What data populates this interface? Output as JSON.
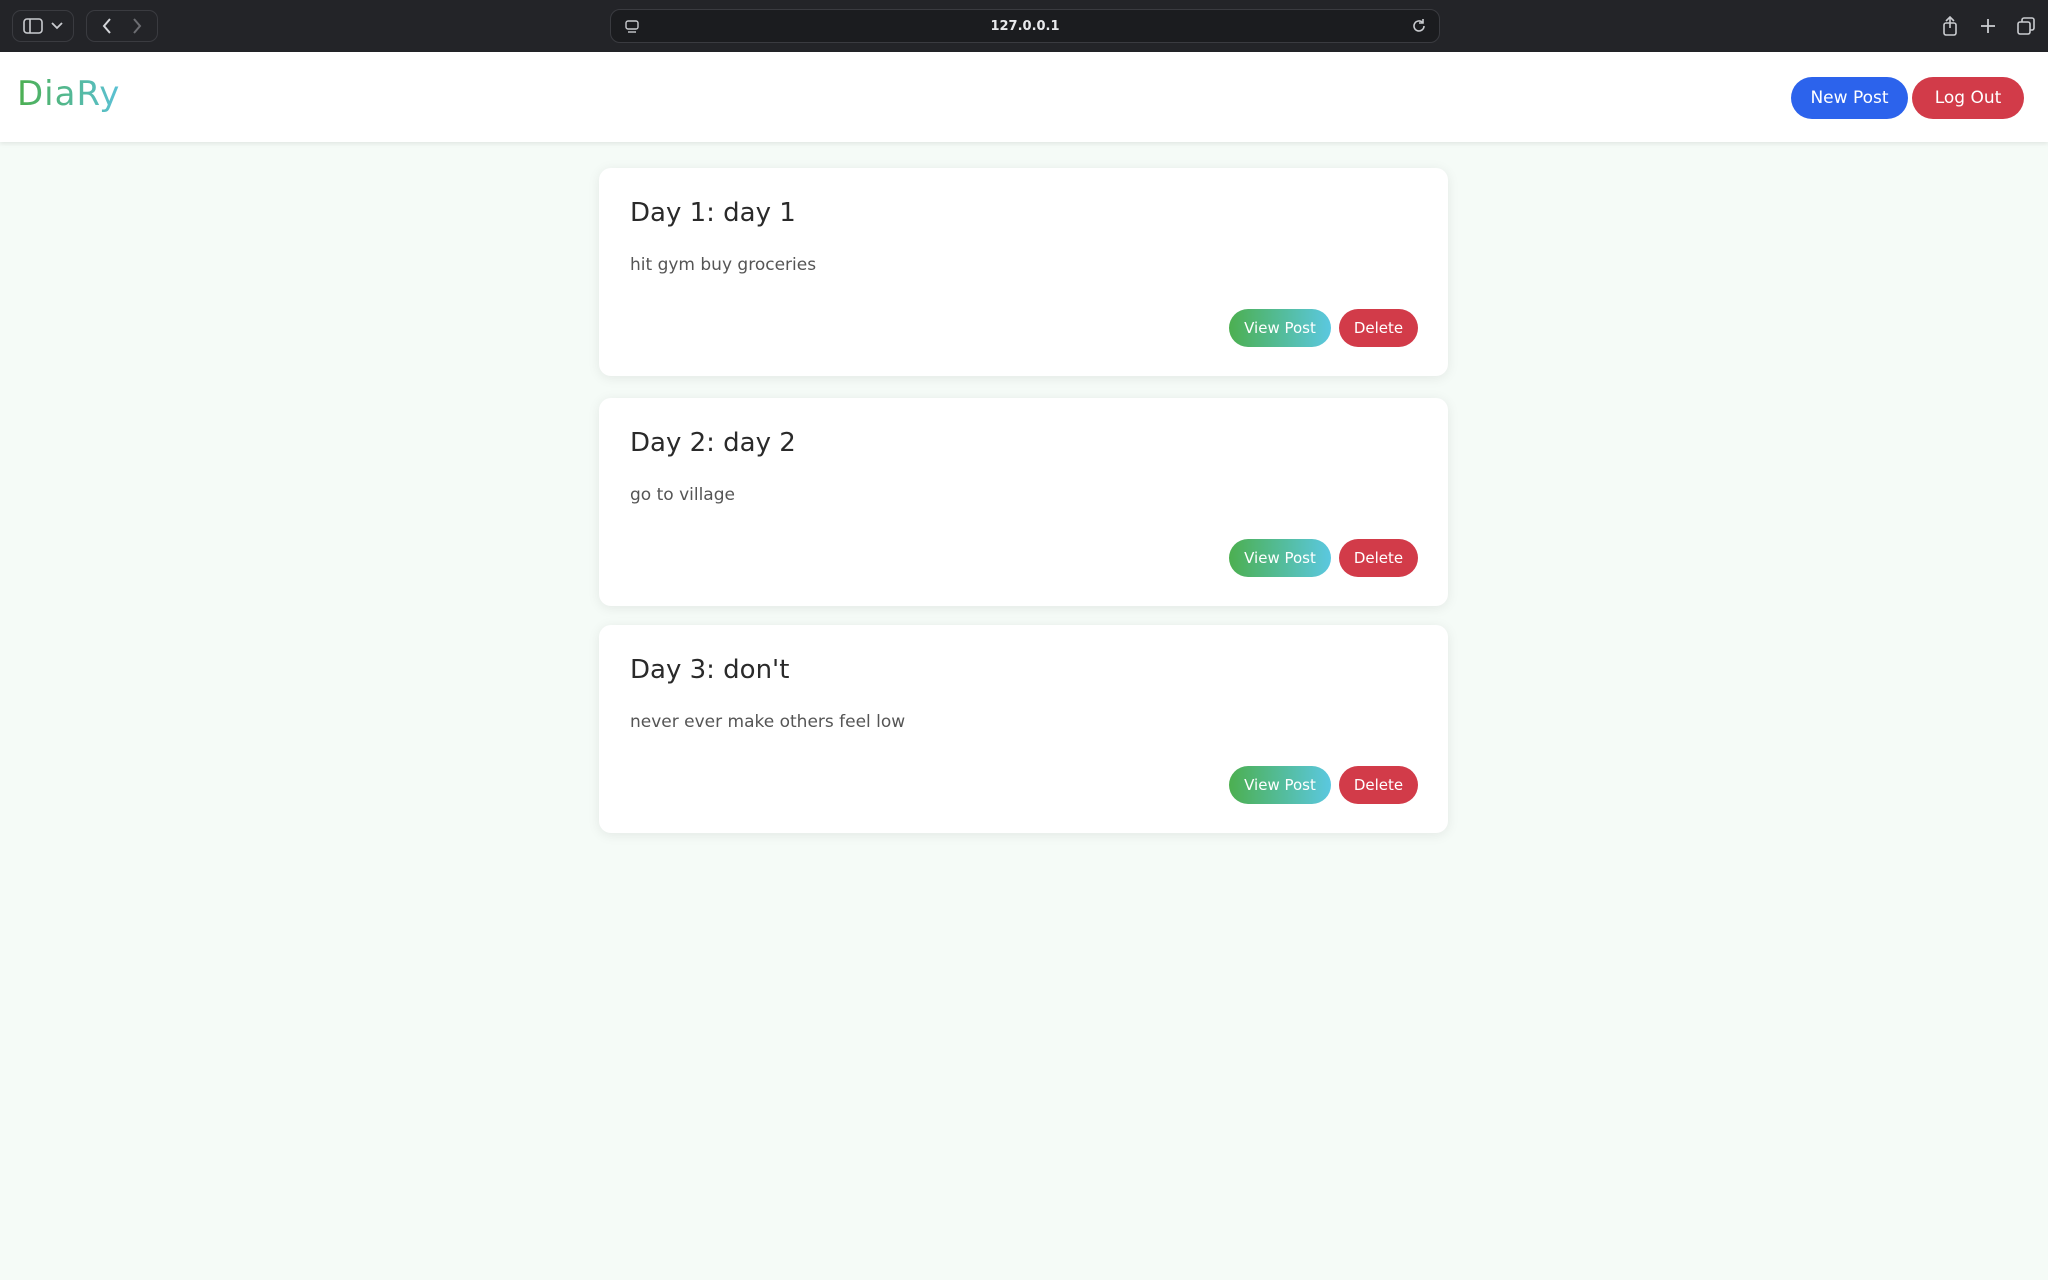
{
  "browser": {
    "url": "127.0.0.1"
  },
  "app": {
    "logo": "DiaRy",
    "new_post_label": "New Post",
    "log_out_label": "Log Out"
  },
  "posts": [
    {
      "title": "Day 1: day 1",
      "body": "hit gym buy groceries",
      "view_label": "View Post",
      "delete_label": "Delete"
    },
    {
      "title": "Day 2: day 2",
      "body": "go to village",
      "view_label": "View Post",
      "delete_label": "Delete"
    },
    {
      "title": "Day 3: don't",
      "body": "never ever make others feel low",
      "view_label": "View Post",
      "delete_label": "Delete"
    }
  ],
  "colors": {
    "primary": "#2c63ec",
    "danger": "#d23b49",
    "gradient_start": "#4caf50",
    "gradient_end": "#5bc8e0",
    "page_bg": "#f5fbf7"
  }
}
